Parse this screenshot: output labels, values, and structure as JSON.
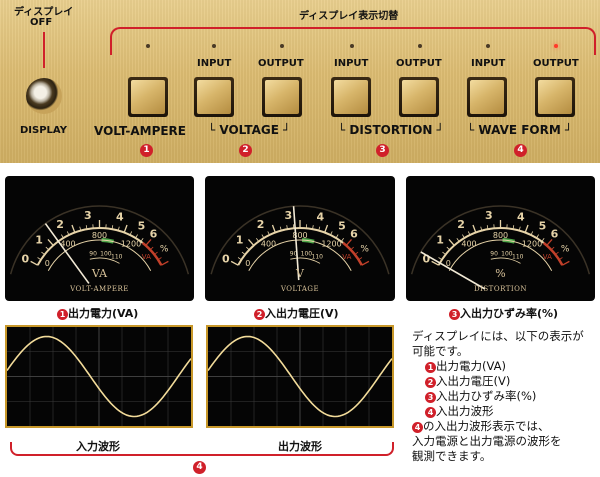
{
  "top_panel": {
    "display_off_label_line1": "ディスプレイ",
    "display_off_label_line2": "OFF",
    "display_label": "DISPLAY",
    "switch_title": "ディスプレイ表示切替",
    "groups": [
      {
        "title": "VOLT-AMPERE",
        "number": "1"
      },
      {
        "title": "VOLTAGE",
        "number": "2"
      },
      {
        "title": "DISTORTION",
        "number": "3"
      },
      {
        "title": "WAVE FORM",
        "number": "4"
      }
    ],
    "input_label": "INPUT",
    "output_label": "OUTPUT",
    "active_led_index": 6,
    "led_on_color": "#ff3a2a",
    "accent_color": "#d0202a"
  },
  "meters": [
    {
      "unit": "VA",
      "name": "VOLT-AMPERE",
      "caption_number": "1",
      "caption": "出力電力(VA)"
    },
    {
      "unit": "V",
      "name": "VOLTAGE",
      "caption_number": "2",
      "caption": "入出力電圧(V)"
    },
    {
      "unit": "%",
      "name": "DISTORTION",
      "caption_number": "3",
      "caption": "入出力ひずみ率(%)"
    }
  ],
  "meter_scale": {
    "upper_ticks": [
      "0",
      "1",
      "2",
      "3",
      "4",
      "5",
      "6"
    ],
    "mid_ticks": [
      "0",
      "400",
      "800",
      "1200"
    ],
    "mid_unit": "VA",
    "lower_ticks": [
      "90",
      "100",
      "110"
    ],
    "percent_label": "%"
  },
  "scopes": [
    {
      "caption": "入力波形"
    },
    {
      "caption": "出力波形"
    }
  ],
  "scope_group_number": "4",
  "description": {
    "lines": [
      "ディスプレイには、以下の表示が",
      "可能です。"
    ],
    "items": [
      {
        "number": "1",
        "text": "出力電力(VA)"
      },
      {
        "number": "2",
        "text": "入出力電圧(V)"
      },
      {
        "number": "3",
        "text": "入出力ひずみ率(%)"
      },
      {
        "number": "4",
        "text": "入出力波形"
      }
    ],
    "note_number": "4",
    "note_lines": [
      "の入出力波形表示では、",
      "入力電源と出力電源の波形を",
      "観測できます。"
    ]
  }
}
